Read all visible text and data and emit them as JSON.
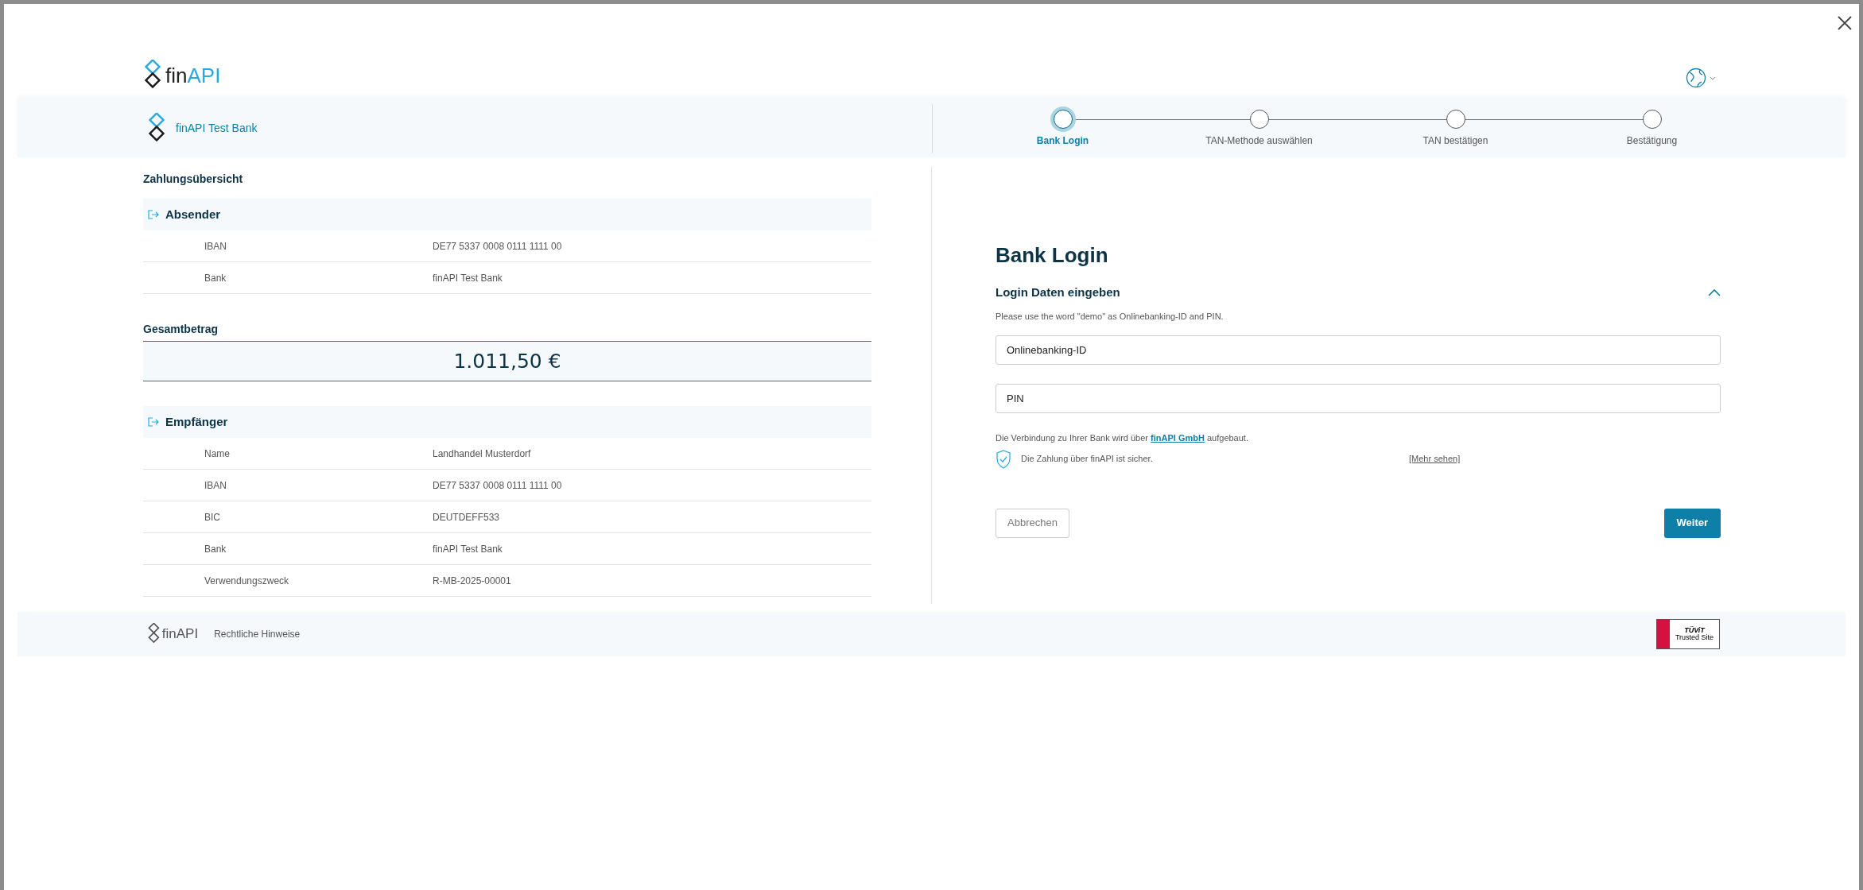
{
  "header": {
    "logo": {
      "part_1": "fin",
      "part_2": "API"
    }
  },
  "bank": {
    "name": "finAPI Test Bank"
  },
  "steps": [
    {
      "label": "Bank Login",
      "selected": true
    },
    {
      "label": "TAN-Methode auswählen",
      "selected": false
    },
    {
      "label": "TAN bestätigen",
      "selected": false
    },
    {
      "label": "Bestätigung",
      "selected": false
    }
  ],
  "summary": {
    "title": "Zahlungsübersicht",
    "sender": {
      "title": "Absender",
      "rows": [
        {
          "label": "IBAN",
          "value": "DE77 5337 0008 0111 1111 00"
        },
        {
          "label": "Bank",
          "value": "finAPI Test Bank"
        }
      ]
    },
    "total": {
      "title": "Gesamtbetrag",
      "amount": "1.011,50 €"
    },
    "recipient": {
      "title": "Empfänger",
      "rows": [
        {
          "label": "Name",
          "value": "Landhandel Musterdorf"
        },
        {
          "label": "IBAN",
          "value": "DE77 5337 0008 0111 1111 00"
        },
        {
          "label": "BIC",
          "value": "DEUTDEFF533"
        },
        {
          "label": "Bank",
          "value": "finAPI Test Bank"
        },
        {
          "label": "Verwendungszweck",
          "value": "R-MB-2025-00001"
        }
      ]
    }
  },
  "login": {
    "title": "Bank Login",
    "section": "Login Daten eingeben",
    "expanded": true,
    "hint": "Please use the word \"demo\" as Onlinebanking-ID and PIN.",
    "fields": [
      {
        "placeholder": "Onlinebanking-ID"
      },
      {
        "placeholder": "PIN"
      }
    ],
    "connection": {
      "before": "Die Verbindung zu Ihrer Bank wird über",
      "link": "finAPI GmbH",
      "after": "aufgebaut."
    },
    "secure": "Die Zahlung über finAPI ist sicher.",
    "more": "[Mehr sehen]",
    "cancel": "Abbrechen",
    "next": "Weiter"
  },
  "footer": {
    "logo": {
      "part_1": "fin",
      "part_2": "API"
    },
    "legal": "Rechtliche Hinweise",
    "badge": {
      "brand": "TÜViT",
      "caption": "Trusted Site"
    }
  }
}
